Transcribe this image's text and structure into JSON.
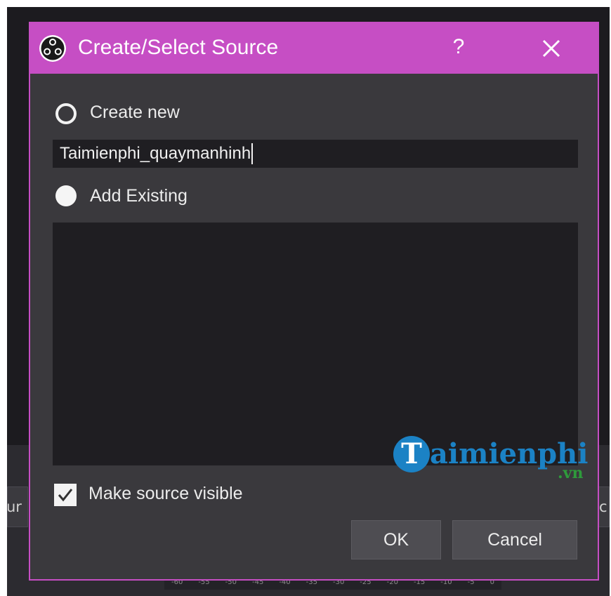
{
  "dialog": {
    "title": "Create/Select Source",
    "help_label": "?",
    "close_icon": "close-icon",
    "logo_icon": "obs-logo-icon",
    "accent_color": "#c64ec4"
  },
  "options": {
    "create_new_label": "Create new",
    "create_new_selected": false,
    "name_value": "Taimienphi_quaymanhinh",
    "add_existing_label": "Add Existing",
    "add_existing_selected": true,
    "existing_sources": []
  },
  "visibility": {
    "label": "Make source visible",
    "checked": true
  },
  "buttons": {
    "ok_label": "OK",
    "cancel_label": "Cancel"
  },
  "watermark": {
    "brand_letter": "T",
    "brand_text": "aimienphi",
    "suffix": ".vn"
  },
  "background": {
    "left_button_text": "ur",
    "right_button_text": "c",
    "meter_ticks": [
      "-60",
      "-55",
      "-50",
      "-45",
      "-40",
      "-35",
      "-30",
      "-25",
      "-20",
      "-15",
      "-10",
      "-5",
      "0"
    ]
  }
}
